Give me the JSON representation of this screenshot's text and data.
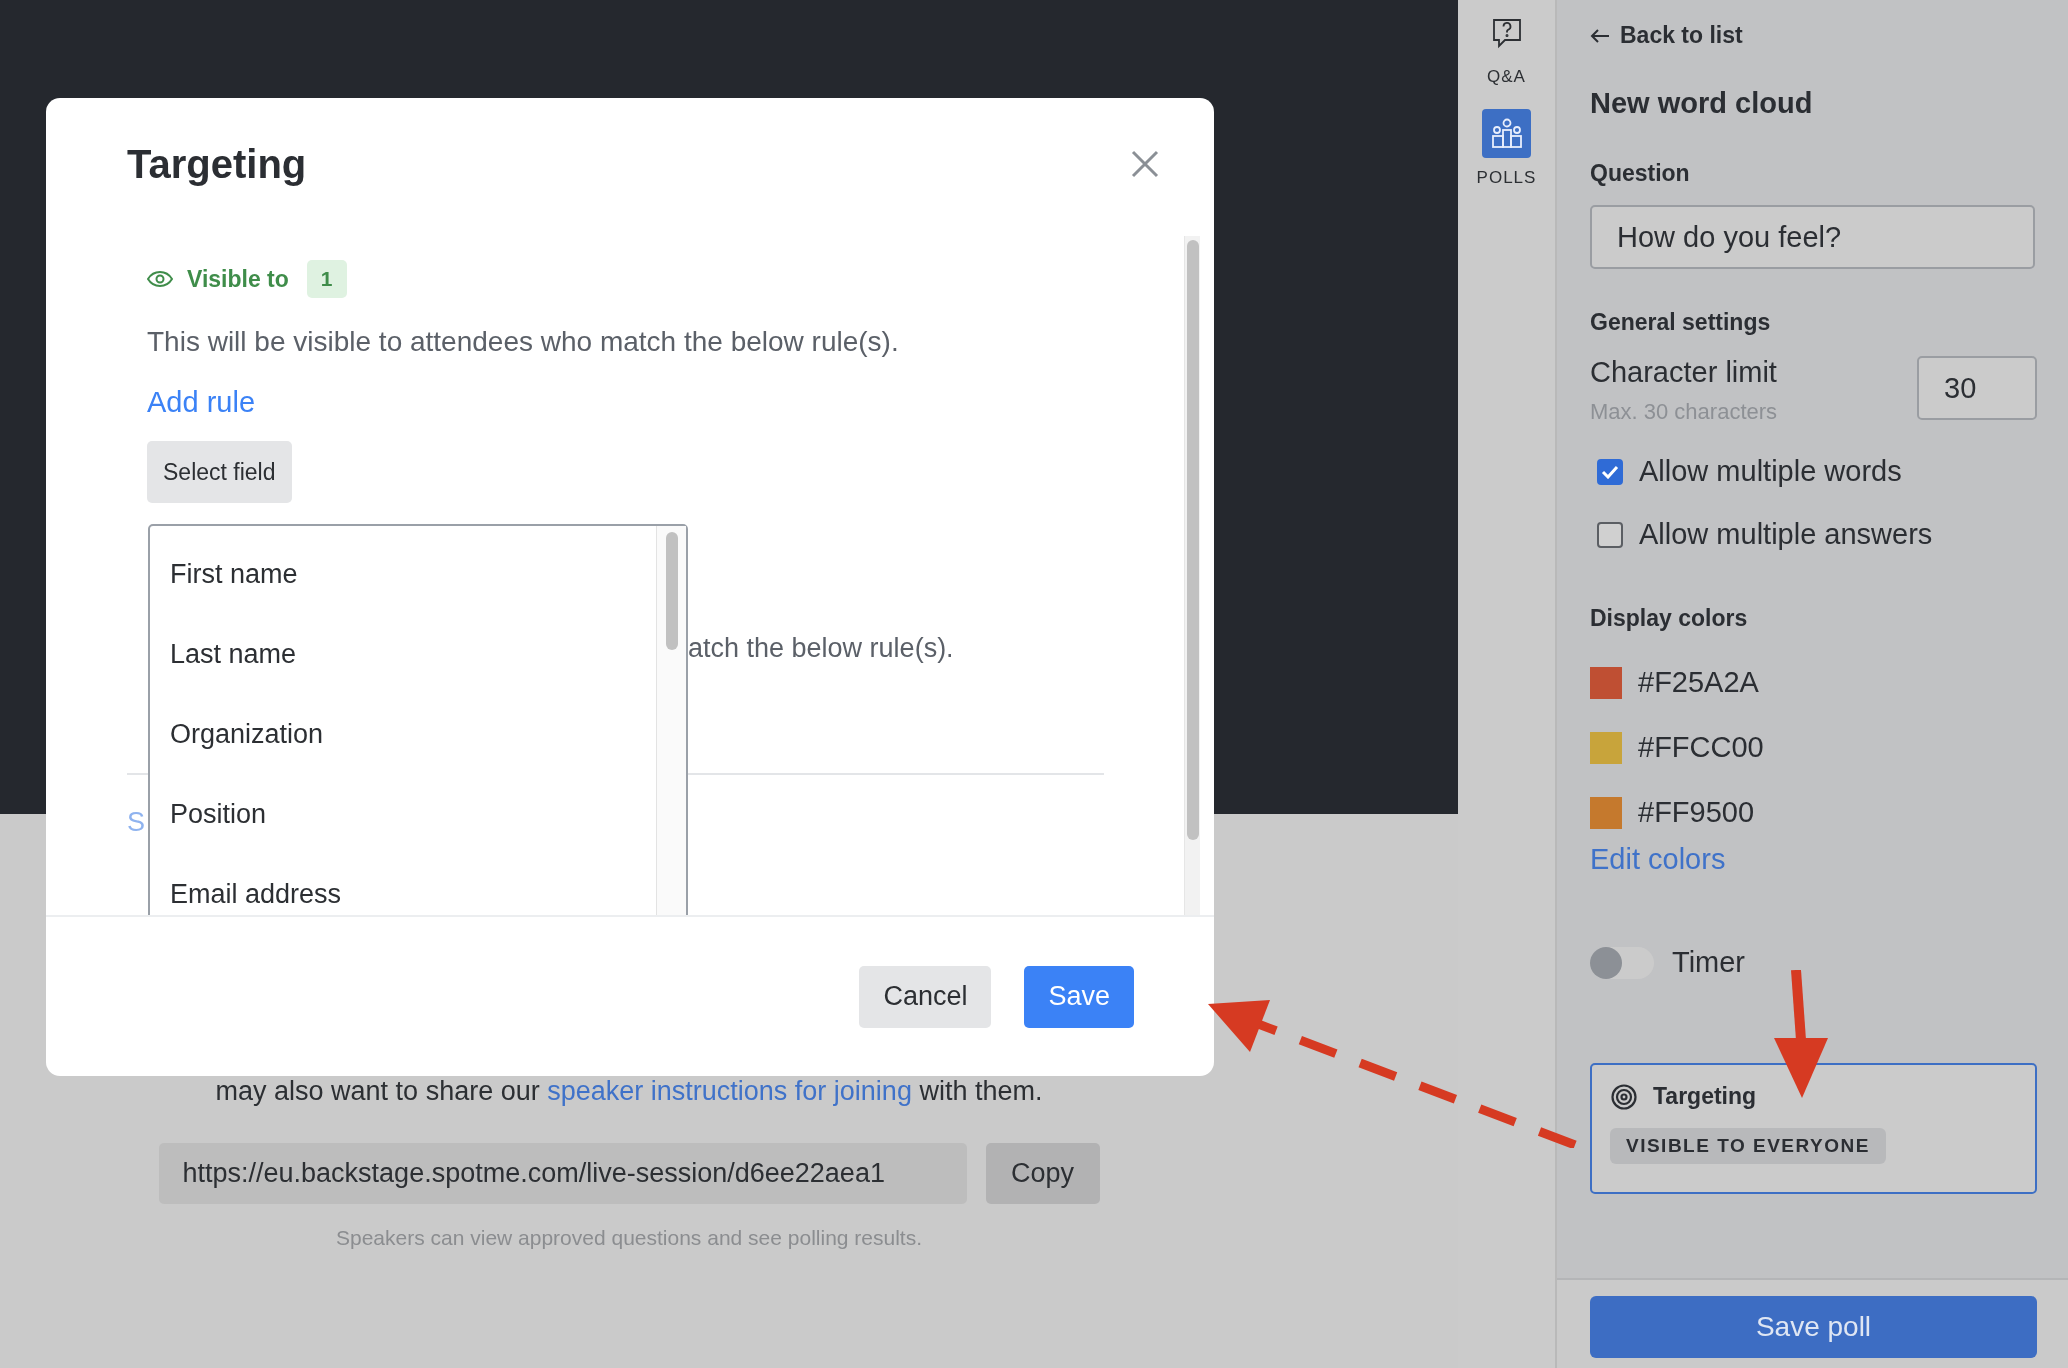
{
  "modal": {
    "title": "Targeting",
    "visible_label": "Visible to",
    "visible_count": "1",
    "description": "This will be visible to attendees who match the below rule(s).",
    "add_rule": "Add rule",
    "select_field": "Select field",
    "field_options": [
      "First name",
      "Last name",
      "Organization",
      "Position",
      "Email address"
    ],
    "covered_text": "atch the below rule(s).",
    "covered_link": "S",
    "cancel": "Cancel",
    "save": "Save"
  },
  "background": {
    "sentence_start": "may also want to share our ",
    "sentence_link": "speaker instructions for joining",
    "sentence_end": " with them.",
    "url": "https://eu.backstage.spotme.com/live-session/d6ee22aea1",
    "copy": "Copy",
    "caption": "Speakers can view approved questions and see polling results."
  },
  "rail": [
    {
      "kind": "qa",
      "label": "Q&A",
      "selected": false
    },
    {
      "kind": "polls",
      "label": "POLLS",
      "selected": true
    }
  ],
  "panel": {
    "back": "Back to list",
    "title": "New word cloud",
    "question_label": "Question",
    "question_value": "How do you feel?",
    "general_settings": "General settings",
    "char_limit_label": "Character limit",
    "char_limit_hint": "Max. 30 characters",
    "char_limit_value": "30",
    "checkboxes": [
      {
        "label": "Allow multiple words",
        "checked": true
      },
      {
        "label": "Allow multiple answers",
        "checked": false
      }
    ],
    "display_colors": "Display colors",
    "colors": [
      {
        "label": "#F25A2A",
        "color": "#bf4f33"
      },
      {
        "label": "#FFCC00",
        "color": "#c8a43b"
      },
      {
        "label": "#FF9500",
        "color": "#c5792d"
      }
    ],
    "edit_colors": "Edit colors",
    "timer": {
      "label": "Timer",
      "on": false
    },
    "targeting": {
      "title": "Targeting",
      "badge": "VISIBLE TO EVERYONE"
    },
    "save_poll": "Save poll"
  }
}
